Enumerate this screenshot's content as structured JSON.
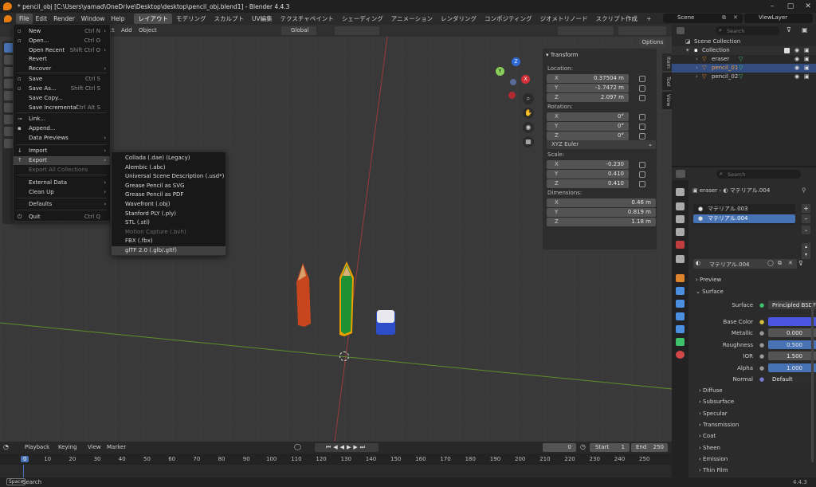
{
  "window": {
    "title": "* pencil_obj [C:\\Users\\yamad\\OneDrive\\Desktop\\desktop\\pencil_obj.blend1] - Blender 4.4.3"
  },
  "menus": [
    "File",
    "Edit",
    "Render",
    "Window",
    "Help"
  ],
  "workspaces": [
    "レイアウト",
    "モデリング",
    "スカルプト",
    "UV編集",
    "テクスチャペイント",
    "シェーディング",
    "アニメーション",
    "レンダリング",
    "コンポジティング",
    "ジオメトリノード",
    "スクリプト作成"
  ],
  "scene": {
    "label": "Scene",
    "view_layer": "ViewLayer"
  },
  "viewport_header": {
    "mode_tail": "ct",
    "add": "Add",
    "object": "Object",
    "orientation": "Global",
    "options": "Options"
  },
  "file_menu": [
    {
      "label": "New",
      "shortcut": "Ctrl N",
      "arrow": "›",
      "icon": "▫"
    },
    {
      "label": "Open...",
      "shortcut": "Ctrl O",
      "icon": "▫"
    },
    {
      "label": "Open Recent",
      "shortcut": "Shift Ctrl O",
      "arrow": "›"
    },
    {
      "label": "Revert"
    },
    {
      "label": "Recover",
      "arrow": "›"
    },
    {
      "label": "Save",
      "shortcut": "Ctrl S",
      "icon": "▫"
    },
    {
      "label": "Save As...",
      "shortcut": "Shift Ctrl S",
      "icon": "▫"
    },
    {
      "label": "Save Copy..."
    },
    {
      "label": "Save Incremental",
      "shortcut": "Ctrl Alt S"
    },
    {
      "label": "Link...",
      "icon": "⊸"
    },
    {
      "label": "Append...",
      "icon": "▪"
    },
    {
      "label": "Data Previews",
      "arrow": "›"
    },
    {
      "label": "Import",
      "arrow": "›",
      "icon": "↓"
    },
    {
      "label": "Export",
      "arrow": "›",
      "icon": "↑"
    },
    {
      "label": "Export All Collections"
    },
    {
      "label": "External Data",
      "arrow": "›"
    },
    {
      "label": "Clean Up",
      "arrow": "›"
    },
    {
      "label": "Defaults",
      "arrow": "›"
    },
    {
      "label": "Quit",
      "shortcut": "Ctrl Q",
      "icon": "⏻"
    }
  ],
  "export_menu": [
    "Collada (.dae) (Legacy)",
    "Alembic (.abc)",
    "Universal Scene Description (.usd*)",
    "Grease Pencil as SVG",
    "Grease Pencil as PDF",
    "Wavefront (.obj)",
    "Stanford PLY (.ply)",
    "STL (.stl)",
    "Motion Capture (.bvh)",
    "FBX (.fbx)",
    "glTF 2.0 (.glb/.gltf)"
  ],
  "transform_panel": {
    "title": "Transform",
    "location_label": "Location:",
    "location": [
      {
        "axis": "X",
        "value": "0.37504 m"
      },
      {
        "axis": "Y",
        "value": "-1.7472 m"
      },
      {
        "axis": "Z",
        "value": "2.097 m"
      }
    ],
    "rotation_label": "Rotation:",
    "rotation": [
      {
        "axis": "X",
        "value": "0°"
      },
      {
        "axis": "Y",
        "value": "0°"
      },
      {
        "axis": "Z",
        "value": "0°"
      }
    ],
    "rotation_mode": "XYZ Euler",
    "scale_label": "Scale:",
    "scale": [
      {
        "axis": "X",
        "value": "-0.230"
      },
      {
        "axis": "Y",
        "value": "0.410"
      },
      {
        "axis": "Z",
        "value": "0.410"
      }
    ],
    "dimensions_label": "Dimensions:",
    "dimensions": [
      {
        "axis": "X",
        "value": "0.46 m"
      },
      {
        "axis": "Y",
        "value": "0.819 m"
      },
      {
        "axis": "Z",
        "value": "1.18 m"
      }
    ]
  },
  "side_tabs": [
    "Item",
    "Tool",
    "View"
  ],
  "gizmo": {
    "x": "X",
    "y": "Y",
    "z": "Z"
  },
  "outliner": {
    "search_placeholder": "Search",
    "scene_collection": "Scene Collection",
    "collection": "Collection",
    "objects": [
      "eraser",
      "pencil_01",
      "pencil_02"
    ]
  },
  "properties": {
    "search_placeholder": "Search",
    "breadcrumb_object": "eraser",
    "breadcrumb_material": "マテリアル.004",
    "material_slots": [
      "マテリアル.003",
      "マテリアル.004"
    ],
    "material_name": "マテリアル.004",
    "preview": "Preview",
    "surface_section": "Surface",
    "surface_label": "Surface",
    "surface_value": "Principled BSDF",
    "base_color_label": "Base Color",
    "base_color": "#4a55e0",
    "fields": [
      {
        "label": "Metallic",
        "value": "0.000",
        "blue": false
      },
      {
        "label": "Roughness",
        "value": "0.500",
        "blue": true
      },
      {
        "label": "IOR",
        "value": "1.500",
        "blue": false
      },
      {
        "label": "Alpha",
        "value": "1.000",
        "blue": true
      }
    ],
    "normal_label": "Normal",
    "normal_value": "Default",
    "sections": [
      "Diffuse",
      "Subsurface",
      "Specular",
      "Transmission",
      "Coat",
      "Sheen",
      "Emission",
      "Thin Film"
    ]
  },
  "timeline": {
    "playback": "Playback",
    "keying": "Keying",
    "view": "View",
    "marker": "Marker",
    "current_frame": "0",
    "start_label": "Start",
    "start": "1",
    "end_label": "End",
    "end": "250",
    "ruler": [
      "0",
      "10",
      "20",
      "30",
      "40",
      "50",
      "60",
      "70",
      "80",
      "90",
      "100",
      "110",
      "120",
      "130",
      "140",
      "150",
      "160",
      "170",
      "180",
      "190",
      "200",
      "210",
      "220",
      "230",
      "240",
      "250"
    ]
  },
  "statusbar": {
    "key": "Space",
    "action": "Search",
    "version": "4.4.3"
  }
}
